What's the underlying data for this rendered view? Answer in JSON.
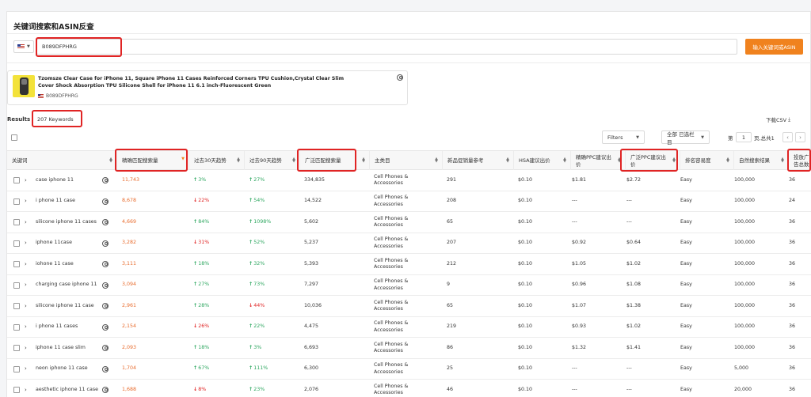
{
  "page_title": "关键词搜索和ASIN反查",
  "search": {
    "value": "B089DFPHRG",
    "button_label": "输入关键词或ASIN"
  },
  "product": {
    "title": "Tzomsze Clear Case for iPhone 11, Square iPhone 11 Cases Reinforced Corners TPU Cushion,Crystal Clear Slim Cover Shock Absorption TPU Silicone Shell for iPhone 11 6.1 inch-Fluorescent Green",
    "asin": "B089DFPHRG"
  },
  "results": {
    "label": "Results",
    "count": "207 Keywords",
    "download_csv": "下载CSV",
    "filters_label": "Filters",
    "columns_select": "全部 已选栏目",
    "page_prefix": "第",
    "page_value": "1",
    "page_suffix": "页,总共1"
  },
  "colors": {
    "accent": "#f0821e",
    "highlight": "#e02424",
    "up": "#2ea760",
    "down": "#e02424",
    "exact": "#e86b2c"
  },
  "columns": [
    "关键词",
    "",
    "精确匹配搜索量",
    "过去30天趋势",
    "过去90天趋势",
    "广泛匹配搜索量",
    "主类目",
    "新品促销量参考",
    "HSA建议出价",
    "精确PPC建议出价",
    "广泛PPC建议出价",
    "排名容易度",
    "自然搜索结果",
    "投放广告总数"
  ],
  "rows": [
    {
      "keyword": "case iphone 11",
      "exact": "11,743",
      "t30_dir": "up",
      "t30": "3%",
      "t90_dir": "up",
      "t90": "27%",
      "broad": "334,835",
      "category": "Cell Phones & Accessories",
      "promo": "291",
      "hsa": "$0.10",
      "ppc_exact": "$1.81",
      "ppc_broad": "$2.72",
      "ease": "Easy",
      "organic": "100,000",
      "ads": "36"
    },
    {
      "keyword": "i phone 11 case",
      "exact": "8,678",
      "t30_dir": "down",
      "t30": "22%",
      "t90_dir": "up",
      "t90": "54%",
      "broad": "14,522",
      "category": "Cell Phones & Accessories",
      "promo": "208",
      "hsa": "$0.10",
      "ppc_exact": "---",
      "ppc_broad": "---",
      "ease": "Easy",
      "organic": "100,000",
      "ads": "24"
    },
    {
      "keyword": "silicone iphone 11 cases",
      "exact": "4,669",
      "t30_dir": "up",
      "t30": "84%",
      "t90_dir": "up",
      "t90": "1098%",
      "broad": "5,602",
      "category": "Cell Phones & Accessories",
      "promo": "65",
      "hsa": "$0.10",
      "ppc_exact": "---",
      "ppc_broad": "---",
      "ease": "Easy",
      "organic": "100,000",
      "ads": "36"
    },
    {
      "keyword": "iphone 11case",
      "exact": "3,282",
      "t30_dir": "down",
      "t30": "31%",
      "t90_dir": "up",
      "t90": "52%",
      "broad": "5,237",
      "category": "Cell Phones & Accessories",
      "promo": "207",
      "hsa": "$0.10",
      "ppc_exact": "$0.92",
      "ppc_broad": "$0.64",
      "ease": "Easy",
      "organic": "100,000",
      "ads": "36"
    },
    {
      "keyword": "iohone 11 case",
      "exact": "3,111",
      "t30_dir": "up",
      "t30": "18%",
      "t90_dir": "up",
      "t90": "32%",
      "broad": "5,393",
      "category": "Cell Phones & Accessories",
      "promo": "212",
      "hsa": "$0.10",
      "ppc_exact": "$1.05",
      "ppc_broad": "$1.02",
      "ease": "Easy",
      "organic": "100,000",
      "ads": "36"
    },
    {
      "keyword": "charging case iphone 11",
      "exact": "3,094",
      "t30_dir": "up",
      "t30": "27%",
      "t90_dir": "up",
      "t90": "73%",
      "broad": "7,297",
      "category": "Cell Phones & Accessories",
      "promo": "9",
      "hsa": "$0.10",
      "ppc_exact": "$0.96",
      "ppc_broad": "$1.08",
      "ease": "Easy",
      "organic": "100,000",
      "ads": "36"
    },
    {
      "keyword": "silicone iphone 11 case",
      "exact": "2,961",
      "t30_dir": "up",
      "t30": "28%",
      "t90_dir": "down",
      "t90": "44%",
      "broad": "10,036",
      "category": "Cell Phones & Accessories",
      "promo": "65",
      "hsa": "$0.10",
      "ppc_exact": "$1.07",
      "ppc_broad": "$1.38",
      "ease": "Easy",
      "organic": "100,000",
      "ads": "36"
    },
    {
      "keyword": "i phone 11 cases",
      "exact": "2,154",
      "t30_dir": "down",
      "t30": "26%",
      "t90_dir": "up",
      "t90": "22%",
      "broad": "4,475",
      "category": "Cell Phones & Accessories",
      "promo": "219",
      "hsa": "$0.10",
      "ppc_exact": "$0.93",
      "ppc_broad": "$1.02",
      "ease": "Easy",
      "organic": "100,000",
      "ads": "36"
    },
    {
      "keyword": "iphone 11 case slim",
      "exact": "2,093",
      "t30_dir": "up",
      "t30": "18%",
      "t90_dir": "up",
      "t90": "3%",
      "broad": "6,693",
      "category": "Cell Phones & Accessories",
      "promo": "86",
      "hsa": "$0.10",
      "ppc_exact": "$1.32",
      "ppc_broad": "$1.41",
      "ease": "Easy",
      "organic": "100,000",
      "ads": "36"
    },
    {
      "keyword": "neon iphone 11 case",
      "exact": "1,704",
      "t30_dir": "up",
      "t30": "67%",
      "t90_dir": "up",
      "t90": "111%",
      "broad": "6,300",
      "category": "Cell Phones & Accessories",
      "promo": "25",
      "hsa": "$0.10",
      "ppc_exact": "---",
      "ppc_broad": "---",
      "ease": "Easy",
      "organic": "5,000",
      "ads": "36"
    },
    {
      "keyword": "aesthetic iphone 11 case",
      "exact": "1,688",
      "t30_dir": "down",
      "t30": "8%",
      "t90_dir": "up",
      "t90": "23%",
      "broad": "2,076",
      "category": "Cell Phones & Accessories",
      "promo": "46",
      "hsa": "$0.10",
      "ppc_exact": "---",
      "ppc_broad": "---",
      "ease": "Easy",
      "organic": "20,000",
      "ads": "36"
    }
  ]
}
